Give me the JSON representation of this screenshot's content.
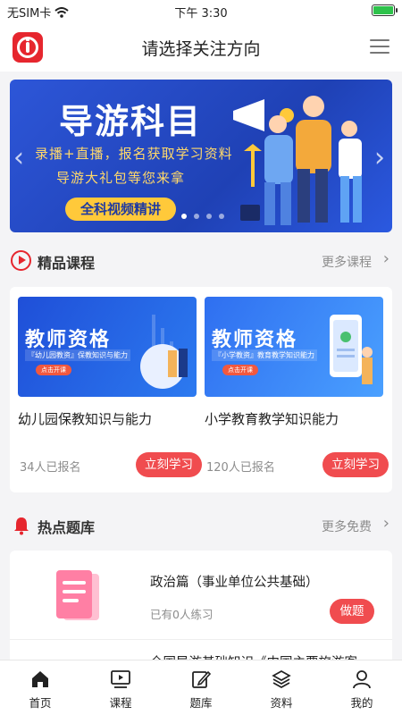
{
  "status_bar": {
    "carrier": "无SIM卡",
    "time": "下午 3:30"
  },
  "header": {
    "title": "请选择关注方向"
  },
  "banner": {
    "title": "导游科目",
    "line1": "录播+直播，报名获取学习资料",
    "line2": "导游大礼包等您来拿",
    "pill": "全科视频精讲"
  },
  "featured": {
    "title": "精品课程",
    "more": "更多课程",
    "courses": [
      {
        "thumb_title": "教师资格",
        "thumb_tag": "『幼儿园教资』保教知识与能力",
        "thumb_button": "点击开课",
        "name": "幼儿园保教知识与能力",
        "enrolled": "34人已报名",
        "button": "立刻学习"
      },
      {
        "thumb_title": "教师资格",
        "thumb_tag": "『小学教资』教育教学知识能力",
        "thumb_button": "点击开课",
        "name": "小学教育教学知识能力",
        "enrolled": "120人已报名",
        "button": "立刻学习"
      }
    ]
  },
  "hot": {
    "title": "热点题库",
    "more": "更多免费",
    "items": [
      {
        "title": "政治篇（事业单位公共基础）",
        "practiced": "已有0人练习",
        "button": "做题"
      },
      {
        "title": "全国导游基础知识《中国主要旅游客",
        "practiced": "",
        "button": ""
      }
    ]
  },
  "tabbar": {
    "items": [
      {
        "label": "首页",
        "icon": "home-icon"
      },
      {
        "label": "课程",
        "icon": "video-icon"
      },
      {
        "label": "题库",
        "icon": "edit-icon"
      },
      {
        "label": "资料",
        "icon": "layers-icon"
      },
      {
        "label": "我的",
        "icon": "user-icon"
      }
    ]
  }
}
